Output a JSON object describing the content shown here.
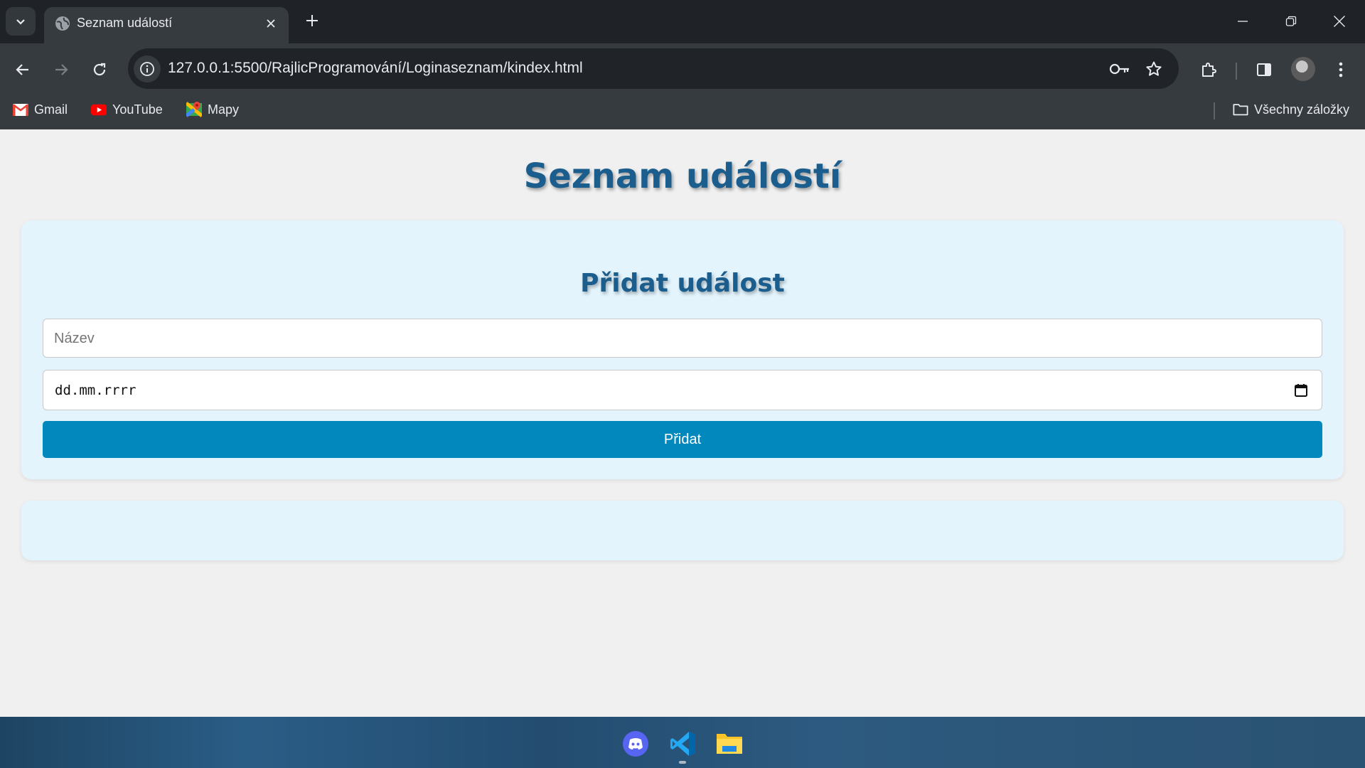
{
  "browser": {
    "tab": {
      "title": "Seznam událostí"
    },
    "address": {
      "url": "127.0.0.1:5500/RajlicProgramování/Loginaseznam/kindex.html"
    },
    "bookmarks": [
      {
        "label": "Gmail",
        "icon": "gmail-icon"
      },
      {
        "label": "YouTube",
        "icon": "youtube-icon"
      },
      {
        "label": "Mapy",
        "icon": "maps-icon"
      }
    ],
    "all_bookmarks_label": "Všechny záložky"
  },
  "page": {
    "title": "Seznam událostí",
    "form": {
      "heading": "Přidat událost",
      "name_placeholder": "Název",
      "date_value": "dd.mm.rrrr",
      "submit_label": "Přidat"
    }
  },
  "taskbar": {
    "apps": [
      "discord-icon",
      "vscode-icon",
      "file-explorer-icon"
    ]
  },
  "colors": {
    "accent": "#0288bd",
    "heading": "#1b5e8e",
    "card": "#e3f4fd"
  }
}
